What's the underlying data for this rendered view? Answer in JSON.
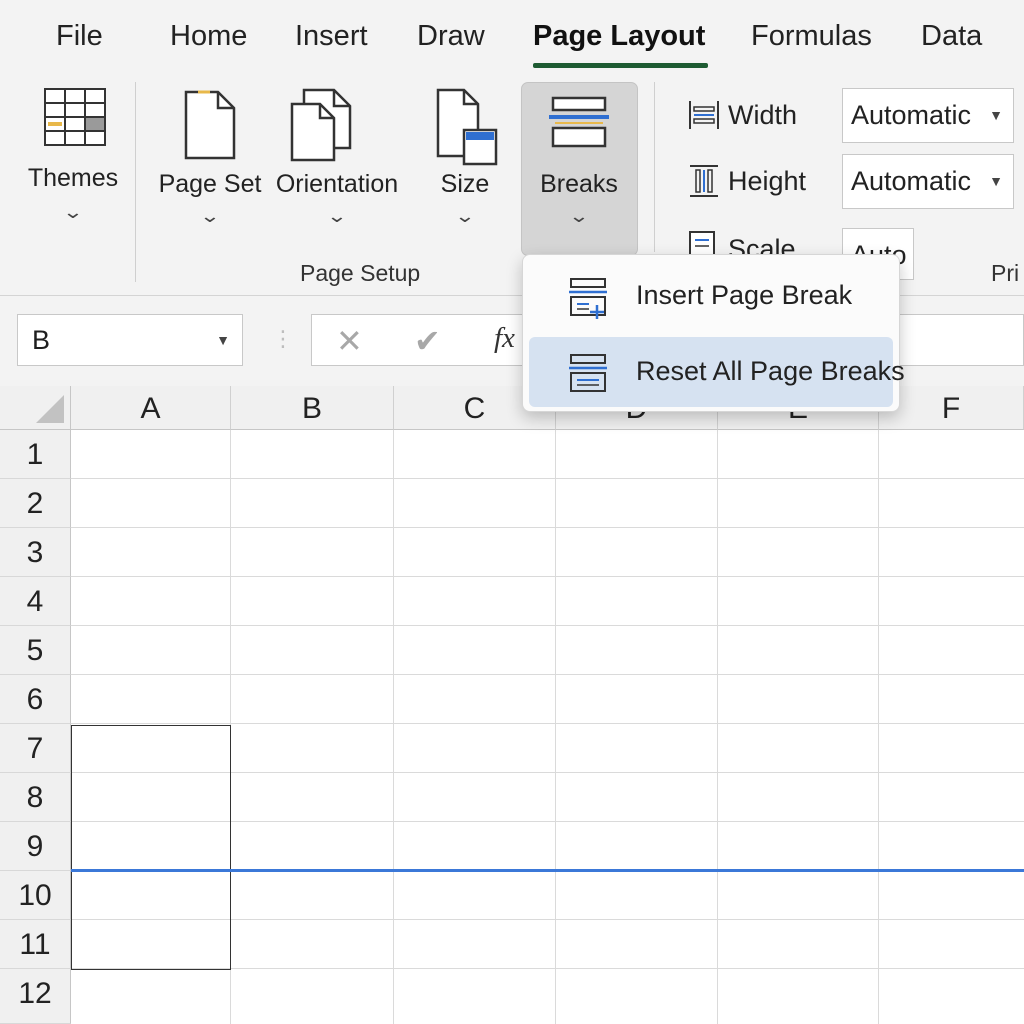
{
  "tabs": [
    {
      "label": "File"
    },
    {
      "label": "Home"
    },
    {
      "label": "Insert"
    },
    {
      "label": "Draw"
    },
    {
      "label": "Page Layout",
      "active": true
    },
    {
      "label": "Formulas"
    },
    {
      "label": "Data"
    }
  ],
  "ribbon": {
    "themes_label": "Themes",
    "page_setup_label": "Page Set",
    "orientation_label": "Orientation",
    "size_label": "Size",
    "breaks_label": "Breaks",
    "page_setup_group": "Page Setup",
    "width_label": "Width",
    "width_value": "Automatic",
    "height_label": "Height",
    "height_value": "Automatic",
    "scale_label": "Scale",
    "scale_value": "Auto",
    "print_group_partial": "Pri"
  },
  "formula_bar": {
    "name_box": "B",
    "fx": "fx"
  },
  "breaks_menu": {
    "items": [
      {
        "label": "Insert Page Break"
      },
      {
        "label": "Reset All Page Breaks",
        "highlighted": true
      }
    ]
  },
  "sheet": {
    "columns": [
      "A",
      "B",
      "C",
      "D",
      "E",
      "F"
    ],
    "rows": [
      "1",
      "2",
      "3",
      "4",
      "5",
      "6",
      "7",
      "8",
      "9",
      "10",
      "11",
      "12"
    ]
  },
  "colors": {
    "accent_underline": "#1e5b32",
    "page_break_line": "#3b78d8",
    "menu_highlight": "#d6e2f1",
    "icon_blue": "#2f6fd1"
  }
}
